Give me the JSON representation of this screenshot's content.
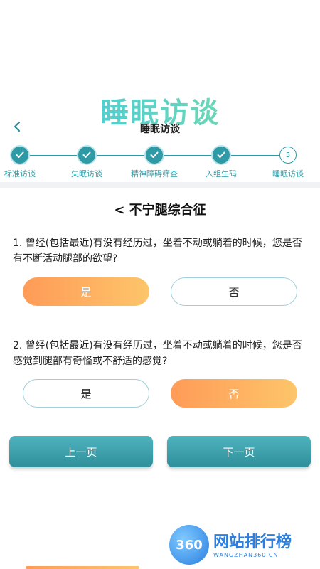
{
  "app": {
    "logo_text": "睡眠访谈"
  },
  "header": {
    "title": "睡眠访谈",
    "back_icon": "chevron-left-icon"
  },
  "steps": [
    {
      "label": "标准访谈",
      "status": "done"
    },
    {
      "label": "失眠访谈",
      "status": "done"
    },
    {
      "label": "精神障碍筛查",
      "status": "done"
    },
    {
      "label": "入组生码",
      "status": "done"
    },
    {
      "label": "睡眠访谈",
      "status": "current",
      "number": "5"
    }
  ],
  "section": {
    "title": "< 不宁腿综合征"
  },
  "questions": [
    {
      "text": "1. 曾经(包括最近)有没有经历过，坐着不动或躺着的时候，您是否有不断活动腿部的欲望?",
      "options": [
        {
          "label": "是",
          "selected": true
        },
        {
          "label": "否",
          "selected": false
        }
      ]
    },
    {
      "text": "2. 曾经(包括最近)有没有经历过，坐着不动或躺着的时候，您是否感觉到腿部有奇怪或不舒适的感觉?",
      "options": [
        {
          "label": "是",
          "selected": false
        },
        {
          "label": "否",
          "selected": true
        }
      ]
    }
  ],
  "nav": {
    "prev_label": "上一页",
    "next_label": "下一页"
  },
  "watermark": {
    "badge": "360",
    "text": "网站排行榜",
    "sub": "WANGZHAN360.CN"
  },
  "colors": {
    "accent": "#2e9aa6",
    "selected_start": "#ff9b57",
    "selected_end": "#fdc56a"
  }
}
